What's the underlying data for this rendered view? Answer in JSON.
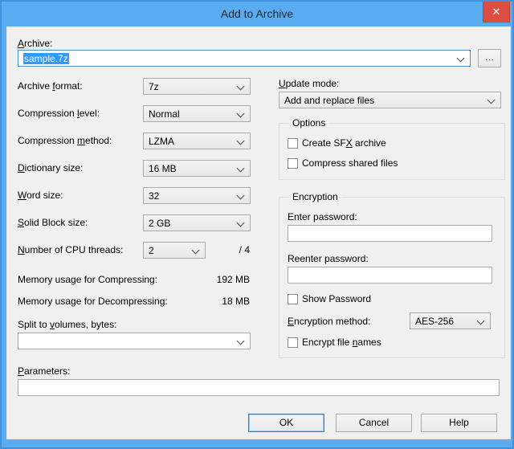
{
  "window": {
    "title": "Add to Archive",
    "close_glyph": "✕"
  },
  "colors": {
    "titlebar": "#5aacf2",
    "close_button": "#dc4d42",
    "dialog_bg": "#f0f0f0",
    "selection": "#3399ff",
    "focus_border": "#4a90da"
  },
  "archive": {
    "label": {
      "text": "Archive:",
      "u": 0
    },
    "value": "sample.7z",
    "browse_label": "…"
  },
  "left_rows": [
    {
      "label": {
        "text": "Archive format:",
        "u": 8
      },
      "value": "7z"
    },
    {
      "label": {
        "text": "Compression level:",
        "u": 12
      },
      "value": "Normal"
    },
    {
      "label": {
        "text": "Compression method:",
        "u": 12
      },
      "value": "LZMA"
    },
    {
      "label": {
        "text": "Dictionary size:",
        "u": 0
      },
      "value": "16 MB"
    },
    {
      "label": {
        "text": "Word size:",
        "u": 0
      },
      "value": "32"
    },
    {
      "label": {
        "text": "Solid Block size:",
        "u": 0
      },
      "value": "2 GB"
    },
    {
      "label": {
        "text": "Number of CPU threads:",
        "u": 0
      },
      "value": "2",
      "suffix": "/ 4"
    }
  ],
  "memory": [
    {
      "label": "Memory usage for Compressing:",
      "value": "192 MB"
    },
    {
      "label": "Memory usage for Decompressing:",
      "value": "18 MB"
    }
  ],
  "split": {
    "label": {
      "text": "Split to volumes, bytes:",
      "u": 9
    },
    "value": ""
  },
  "parameters": {
    "label": {
      "text": "Parameters:",
      "u": 0
    },
    "value": ""
  },
  "update_mode": {
    "label": {
      "text": "Update mode:",
      "u": 0
    },
    "value": "Add and replace files"
  },
  "options_group": {
    "title": "Options",
    "checkboxes": [
      {
        "label": {
          "text": "Create SFX archive",
          "u": 9
        },
        "checked": false
      },
      {
        "label": {
          "text": "Compress shared files",
          "u": -1
        },
        "checked": false
      }
    ]
  },
  "encryption_group": {
    "title": "Encryption",
    "enter_label": "Enter password:",
    "enter_value": "",
    "reenter_label": "Reenter password:",
    "reenter_value": "",
    "show_password": {
      "label": {
        "text": "Show Password",
        "u": -1
      },
      "checked": false
    },
    "method_label": {
      "text": "Encryption method:",
      "u": 0
    },
    "method_value": "AES-256",
    "encrypt_names": {
      "label": {
        "text": "Encrypt file names",
        "u": 13
      },
      "checked": false
    }
  },
  "buttons": {
    "ok": "OK",
    "cancel": "Cancel",
    "help": "Help"
  }
}
